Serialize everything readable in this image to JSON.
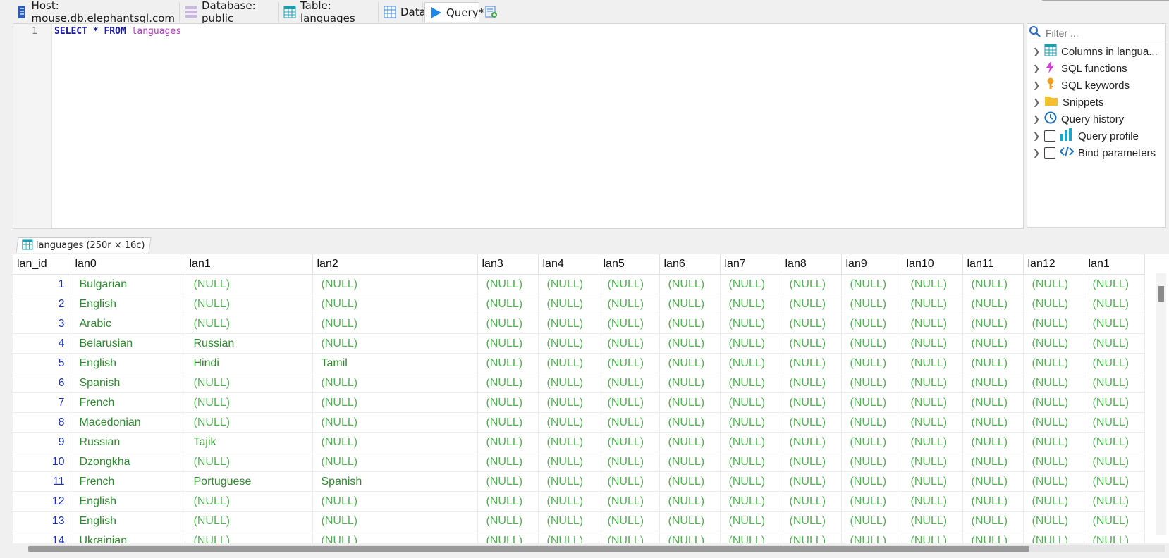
{
  "tabs": [
    {
      "label": "Host: mouse.db.elephantsql.com",
      "icon": "server-icon"
    },
    {
      "label": "Database: public",
      "icon": "database-icon"
    },
    {
      "label": "Table: languages",
      "icon": "table-icon"
    },
    {
      "label": "Data",
      "icon": "grid-icon"
    },
    {
      "label": "Query*",
      "icon": "play-icon"
    }
  ],
  "new_tab_icon": "new-query-tab-icon",
  "editor": {
    "line_number": "1",
    "sql_select": "SELECT",
    "sql_star": "*",
    "sql_from": "FROM",
    "sql_table": "languages"
  },
  "helpers": {
    "filter_placeholder": "Filter ...",
    "items": [
      {
        "label": "Columns in langua...",
        "icon": "table-icon"
      },
      {
        "label": "SQL functions",
        "icon": "lightning-icon"
      },
      {
        "label": "SQL keywords",
        "icon": "key-icon"
      },
      {
        "label": "Snippets",
        "icon": "folder-icon"
      },
      {
        "label": "Query history",
        "icon": "clock-icon"
      },
      {
        "label": "Query profile",
        "icon": "bar-chart-icon"
      },
      {
        "label": "Bind parameters",
        "icon": "code-icon"
      }
    ]
  },
  "result_tab": {
    "label": "languages (250r × 16c)"
  },
  "grid": {
    "columns": [
      "lan_id",
      "lan0",
      "lan1",
      "lan2",
      "lan3",
      "lan4",
      "lan5",
      "lan6",
      "lan7",
      "lan8",
      "lan9",
      "lan10",
      "lan11",
      "lan12",
      "lan1"
    ],
    "null_text": "(NULL)",
    "rows": [
      {
        "id": "1",
        "lan0": "Bulgarian",
        "lan1": "(NULL)",
        "lan2": "(NULL)"
      },
      {
        "id": "2",
        "lan0": "English",
        "lan1": "(NULL)",
        "lan2": "(NULL)"
      },
      {
        "id": "3",
        "lan0": "Arabic",
        "lan1": "(NULL)",
        "lan2": "(NULL)"
      },
      {
        "id": "4",
        "lan0": "Belarusian",
        "lan1": "Russian",
        "lan2": "(NULL)"
      },
      {
        "id": "5",
        "lan0": "English",
        "lan1": "Hindi",
        "lan2": "Tamil"
      },
      {
        "id": "6",
        "lan0": "Spanish",
        "lan1": "(NULL)",
        "lan2": "(NULL)"
      },
      {
        "id": "7",
        "lan0": "French",
        "lan1": "(NULL)",
        "lan2": "(NULL)"
      },
      {
        "id": "8",
        "lan0": "Macedonian",
        "lan1": "(NULL)",
        "lan2": "(NULL)"
      },
      {
        "id": "9",
        "lan0": "Russian",
        "lan1": "Tajik",
        "lan2": "(NULL)"
      },
      {
        "id": "10",
        "lan0": "Dzongkha",
        "lan1": "(NULL)",
        "lan2": "(NULL)"
      },
      {
        "id": "11",
        "lan0": "French",
        "lan1": "Portuguese",
        "lan2": "Spanish"
      },
      {
        "id": "12",
        "lan0": "English",
        "lan1": "(NULL)",
        "lan2": "(NULL)"
      },
      {
        "id": "13",
        "lan0": "English",
        "lan1": "(NULL)",
        "lan2": "(NULL)"
      },
      {
        "id": "14",
        "lan0": "Ukrainian",
        "lan1": "(NULL)",
        "lan2": "(NULL)"
      }
    ]
  },
  "colors": {
    "accent": "#1e88e5",
    "value_text": "#2f8a2f",
    "null_text": "#55b055",
    "id_text": "#1a2fb0"
  }
}
